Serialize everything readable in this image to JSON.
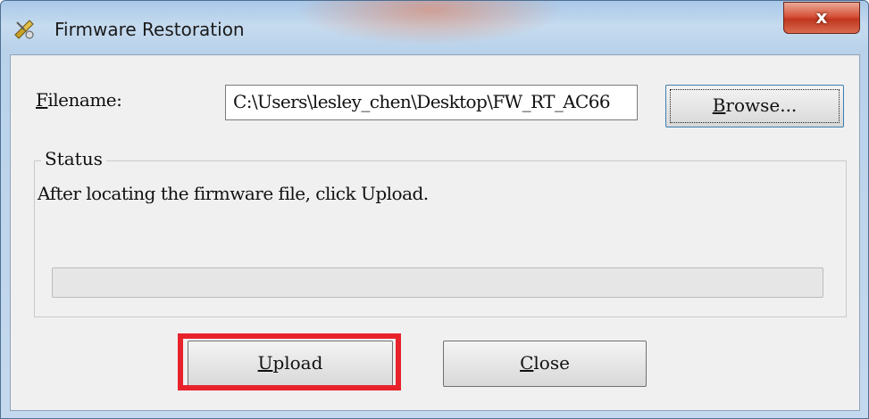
{
  "window": {
    "title": "Firmware Restoration",
    "close_glyph": "x"
  },
  "form": {
    "filename_label_mnemonic": "F",
    "filename_label_rest": "ilename:",
    "filename_value": "C:\\Users\\lesley_chen\\Desktop\\FW_RT_AC66",
    "browse_label_mnemonic": "B",
    "browse_label_rest": "rowse..."
  },
  "status": {
    "group_label": "Status",
    "message": "After locating the firmware file, click Upload.",
    "progress_fraction": 0
  },
  "buttons": {
    "upload_mnemonic": "U",
    "upload_rest": "pload",
    "close_mnemonic": "C",
    "close_rest": "lose"
  },
  "annotation": {
    "highlight_color": "#e8222b"
  },
  "icons": {
    "app": "firmware-restoration-icon",
    "close": "close-icon"
  }
}
